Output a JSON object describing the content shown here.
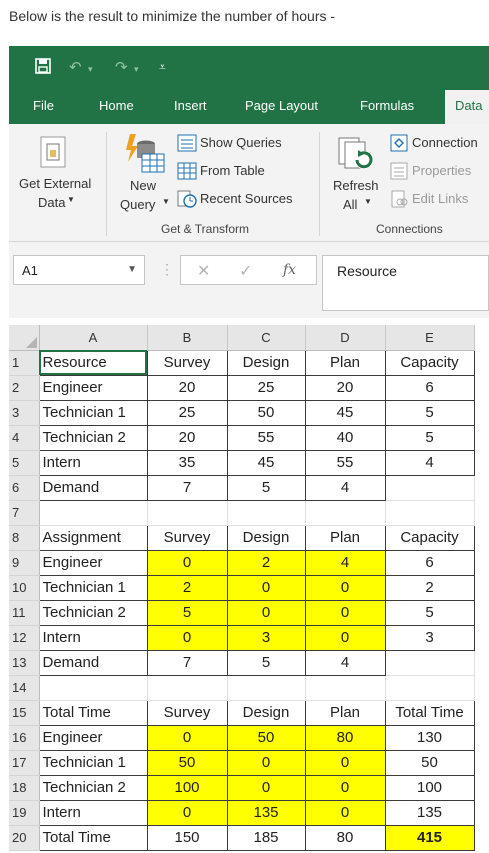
{
  "caption": "Below is the result to minimize the number of hours -",
  "tabs": [
    "File",
    "Home",
    "Insert",
    "Page Layout",
    "Formulas",
    "Data"
  ],
  "active_tab": "Data",
  "ribbon": {
    "get_external_line1": "Get External",
    "get_external_line2": "Data",
    "new_query_line1": "New",
    "new_query_line2": "Query",
    "show_queries": "Show Queries",
    "from_table": "From Table",
    "recent_sources": "Recent Sources",
    "group_get_transform": "Get & Transform",
    "refresh_line1": "Refresh",
    "refresh_line2": "All",
    "connections": "Connection",
    "properties": "Properties",
    "edit_links": "Edit Links",
    "group_connections": "Connections"
  },
  "formula_bar": {
    "name_box": "A1",
    "fx": "fx",
    "content": "Resource"
  },
  "columns": [
    "A",
    "B",
    "C",
    "D",
    "E"
  ],
  "rows": [
    {
      "n": "1",
      "cells": [
        "Resource",
        "Survey",
        "Design",
        "Plan",
        "Capacity"
      ]
    },
    {
      "n": "2",
      "cells": [
        "Engineer",
        "20",
        "25",
        "20",
        "6"
      ]
    },
    {
      "n": "3",
      "cells": [
        "Technician 1",
        "25",
        "50",
        "45",
        "5"
      ]
    },
    {
      "n": "4",
      "cells": [
        "Technician 2",
        "20",
        "55",
        "40",
        "5"
      ]
    },
    {
      "n": "5",
      "cells": [
        "Intern",
        "35",
        "45",
        "55",
        "4"
      ]
    },
    {
      "n": "6",
      "cells": [
        "Demand",
        "7",
        "5",
        "4",
        ""
      ]
    },
    {
      "n": "7",
      "cells": [
        "",
        "",
        "",
        "",
        ""
      ]
    },
    {
      "n": "8",
      "cells": [
        "Assignment",
        "Survey",
        "Design",
        "Plan",
        "Capacity"
      ]
    },
    {
      "n": "9",
      "cells": [
        "Engineer",
        "0",
        "2",
        "4",
        "6"
      ]
    },
    {
      "n": "10",
      "cells": [
        "Technician 1",
        "2",
        "0",
        "0",
        "2"
      ]
    },
    {
      "n": "11",
      "cells": [
        "Technician 2",
        "5",
        "0",
        "0",
        "5"
      ]
    },
    {
      "n": "12",
      "cells": [
        "Intern",
        "0",
        "3",
        "0",
        "3"
      ]
    },
    {
      "n": "13",
      "cells": [
        "Demand",
        "7",
        "5",
        "4",
        ""
      ]
    },
    {
      "n": "14",
      "cells": [
        "",
        "",
        "",
        "",
        ""
      ]
    },
    {
      "n": "15",
      "cells": [
        "Total Time",
        "Survey",
        "Design",
        "Plan",
        "Total Time"
      ]
    },
    {
      "n": "16",
      "cells": [
        "Engineer",
        "0",
        "50",
        "80",
        "130"
      ]
    },
    {
      "n": "17",
      "cells": [
        "Technician 1",
        "50",
        "0",
        "0",
        "50"
      ]
    },
    {
      "n": "18",
      "cells": [
        "Technician 2",
        "100",
        "0",
        "0",
        "100"
      ]
    },
    {
      "n": "19",
      "cells": [
        "Intern",
        "0",
        "135",
        "0",
        "135"
      ]
    },
    {
      "n": "20",
      "cells": [
        "Total Time",
        "150",
        "185",
        "80",
        "415"
      ]
    }
  ],
  "colors": {
    "excel_green": "#217346",
    "highlight_yellow": "#ffff00"
  },
  "icons": [
    "save-icon",
    "undo-icon",
    "redo-icon",
    "customize-qat-icon",
    "get-external-data-icon",
    "new-query-icon",
    "show-queries-icon",
    "from-table-icon",
    "recent-sources-icon",
    "refresh-all-icon",
    "connections-icon",
    "properties-icon",
    "edit-links-icon"
  ]
}
